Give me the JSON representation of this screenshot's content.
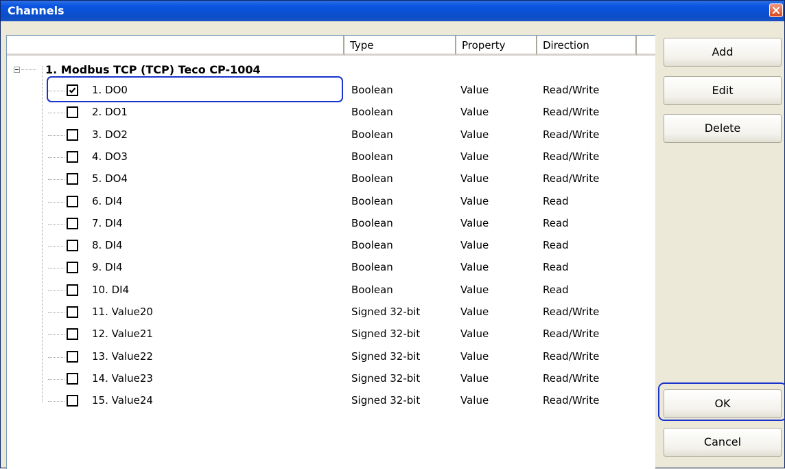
{
  "window": {
    "title": "Channels"
  },
  "columns": {
    "name": "",
    "type": "Type",
    "property": "Property",
    "direction": "Direction"
  },
  "group": {
    "label": "1. Modbus TCP (TCP) Teco CP-1004",
    "expanded": true
  },
  "rows": [
    {
      "name": "1. DO0",
      "type": "Boolean",
      "property": "Value",
      "direction": "Read/Write",
      "checked": true
    },
    {
      "name": "2. DO1",
      "type": "Boolean",
      "property": "Value",
      "direction": "Read/Write",
      "checked": false
    },
    {
      "name": "3. DO2",
      "type": "Boolean",
      "property": "Value",
      "direction": "Read/Write",
      "checked": false
    },
    {
      "name": "4. DO3",
      "type": "Boolean",
      "property": "Value",
      "direction": "Read/Write",
      "checked": false
    },
    {
      "name": "5. DO4",
      "type": "Boolean",
      "property": "Value",
      "direction": "Read/Write",
      "checked": false
    },
    {
      "name": "6. DI4",
      "type": "Boolean",
      "property": "Value",
      "direction": "Read",
      "checked": false
    },
    {
      "name": "7. DI4",
      "type": "Boolean",
      "property": "Value",
      "direction": "Read",
      "checked": false
    },
    {
      "name": "8. DI4",
      "type": "Boolean",
      "property": "Value",
      "direction": "Read",
      "checked": false
    },
    {
      "name": "9. DI4",
      "type": "Boolean",
      "property": "Value",
      "direction": "Read",
      "checked": false
    },
    {
      "name": "10. DI4",
      "type": "Boolean",
      "property": "Value",
      "direction": "Read",
      "checked": false
    },
    {
      "name": "11. Value20",
      "type": "Signed 32-bit",
      "property": "Value",
      "direction": "Read/Write",
      "checked": false
    },
    {
      "name": "12. Value21",
      "type": "Signed 32-bit",
      "property": "Value",
      "direction": "Read/Write",
      "checked": false
    },
    {
      "name": "13. Value22",
      "type": "Signed 32-bit",
      "property": "Value",
      "direction": "Read/Write",
      "checked": false
    },
    {
      "name": "14. Value23",
      "type": "Signed 32-bit",
      "property": "Value",
      "direction": "Read/Write",
      "checked": false
    },
    {
      "name": "15. Value24",
      "type": "Signed 32-bit",
      "property": "Value",
      "direction": "Read/Write",
      "checked": false
    }
  ],
  "buttons": {
    "add": "Add",
    "edit": "Edit",
    "delete": "Delete",
    "ok": "OK",
    "cancel": "Cancel"
  },
  "colors": {
    "title_bar": "#0b4ec9",
    "highlight": "#1a33cc",
    "dialog_bg": "#ece9d8"
  },
  "icons": {
    "close": "close-icon",
    "collapse": "minus-expander-icon",
    "check": "checkmark-icon"
  }
}
